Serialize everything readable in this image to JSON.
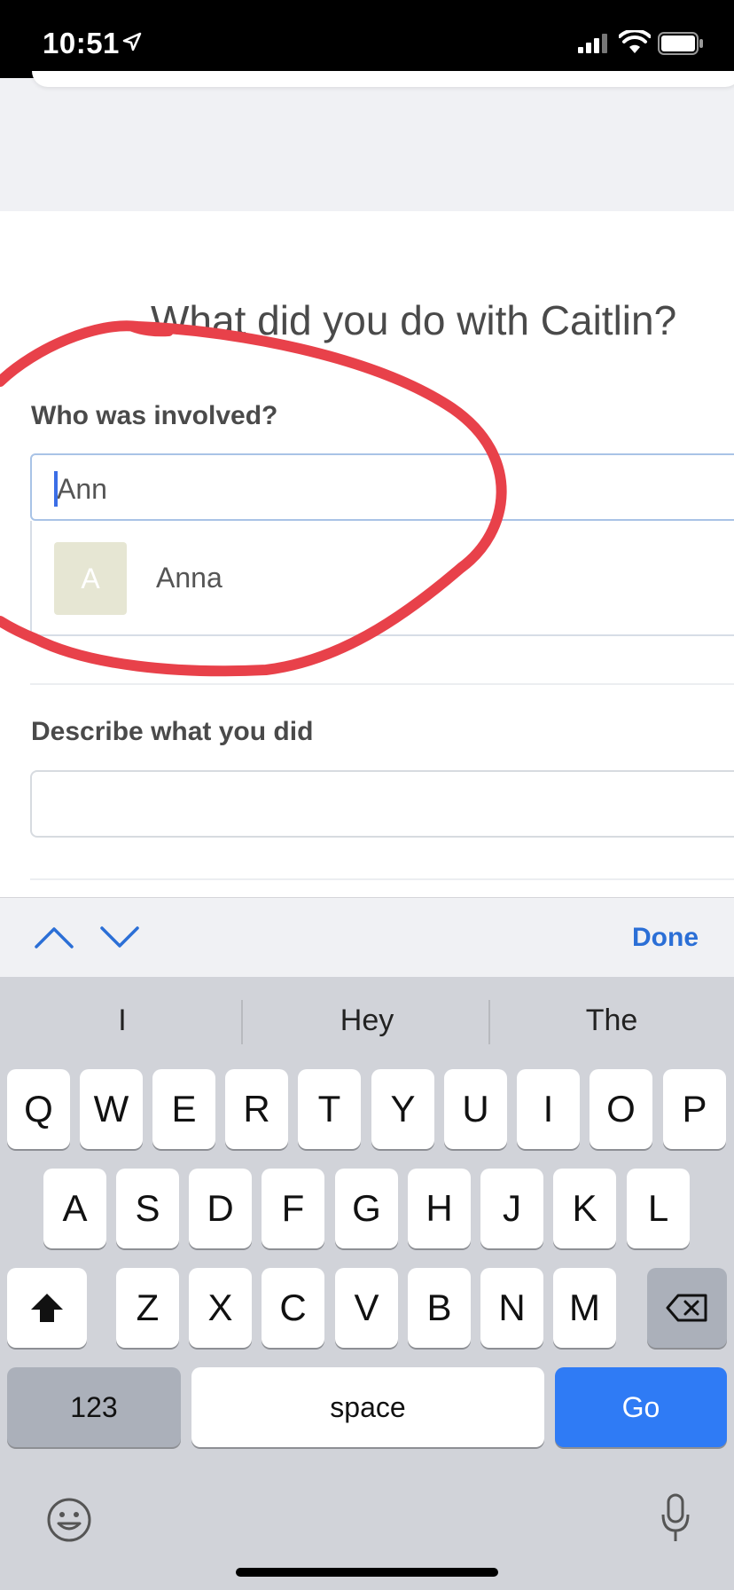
{
  "status_bar": {
    "time": "10:51"
  },
  "form": {
    "question": "What did you do with Caitlin?",
    "who_label": "Who was involved?",
    "who_value": "Ann",
    "suggestions": [
      {
        "initial": "A",
        "name": "Anna"
      }
    ],
    "describe_label": "Describe what you did",
    "describe_value": ""
  },
  "accessory": {
    "done_label": "Done"
  },
  "keyboard": {
    "predictions": [
      "I",
      "Hey",
      "The"
    ],
    "row1": [
      "Q",
      "W",
      "E",
      "R",
      "T",
      "Y",
      "U",
      "I",
      "O",
      "P"
    ],
    "row2": [
      "A",
      "S",
      "D",
      "F",
      "G",
      "H",
      "J",
      "K",
      "L"
    ],
    "row3": [
      "Z",
      "X",
      "C",
      "V",
      "B",
      "N",
      "M"
    ],
    "numbers_label": "123",
    "space_label": "space",
    "go_label": "Go"
  },
  "colors": {
    "accent": "#2f7bf5",
    "done_text": "#2b6fd6",
    "annotation": "#e8414a",
    "avatar_bg": "#e6e6d3"
  }
}
